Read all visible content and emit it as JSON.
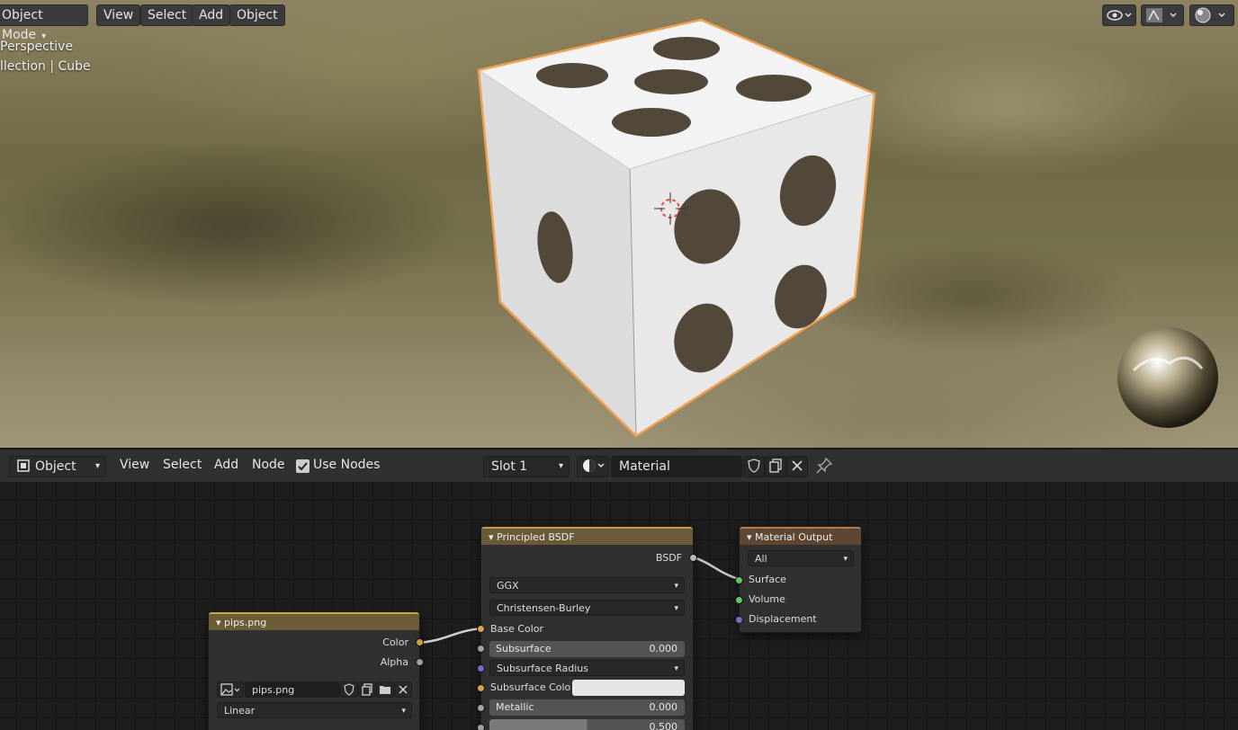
{
  "viewport": {
    "mode": "Object Mode",
    "menu": [
      "View",
      "Select",
      "Add",
      "Object"
    ],
    "overlay_line1": "Perspective",
    "overlay_line2": "llection | Cube"
  },
  "node_editor": {
    "header": {
      "object_type": "Object",
      "menu": [
        "View",
        "Select",
        "Add",
        "Node"
      ],
      "use_nodes_label": "Use Nodes",
      "use_nodes_checked": true,
      "slot": "Slot 1",
      "material": "Material"
    },
    "image_node": {
      "title": "pips.png",
      "outputs": [
        "Color",
        "Alpha"
      ],
      "image_name": "pips.png",
      "interpolation": "Linear"
    },
    "bsdf_node": {
      "title": "Principled BSDF",
      "output": "BSDF",
      "distribution": "GGX",
      "subsurface_method": "Christensen-Burley",
      "base_color_label": "Base Color",
      "subsurface_label": "Subsurface",
      "subsurface_value": "0.000",
      "subsurface_radius_label": "Subsurface Radius",
      "subsurface_color_label": "Subsurface Colo",
      "metallic_label": "Metallic",
      "metallic_value": "0.000",
      "next_value": "0.500"
    },
    "output_node": {
      "title": "Material Output",
      "target": "All",
      "inputs": [
        "Surface",
        "Volume",
        "Displacement"
      ]
    }
  },
  "colors": {
    "selection_outline": "#f0a050",
    "shader_header": "#6b4a3b",
    "texture_header": "#6c5c35",
    "output_header": "#6e3a35"
  }
}
